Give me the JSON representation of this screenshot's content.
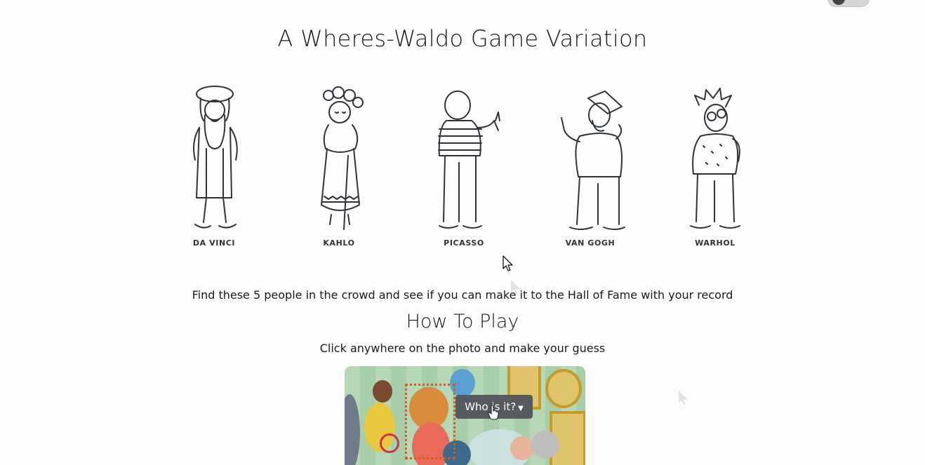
{
  "page": {
    "title": "A Wheres-Waldo Game Variation",
    "tagline": "Find these 5 people in the crowd and see if you can make it to the Hall of Fame with your record",
    "how_to_play": "How To Play",
    "instructions": "Click anywhere on the photo and make your guess"
  },
  "characters": [
    {
      "name": "DA VINCI"
    },
    {
      "name": "KAHLO"
    },
    {
      "name": "PICASSO"
    },
    {
      "name": "VAN GOGH"
    },
    {
      "name": "WARHOL"
    }
  ],
  "puzzle": {
    "dropdown_label": "Who is it?"
  },
  "icons": {
    "theme_toggle": "toggle-switch-icon",
    "cursor": "arrow-cursor-icon",
    "pointer": "hand-pointer-icon",
    "caret": "caret-down-icon"
  },
  "colors": {
    "background": "#fdfdfd",
    "text": "#1a1a1a",
    "button": "#565a5e",
    "selection": "#d95a1a"
  }
}
